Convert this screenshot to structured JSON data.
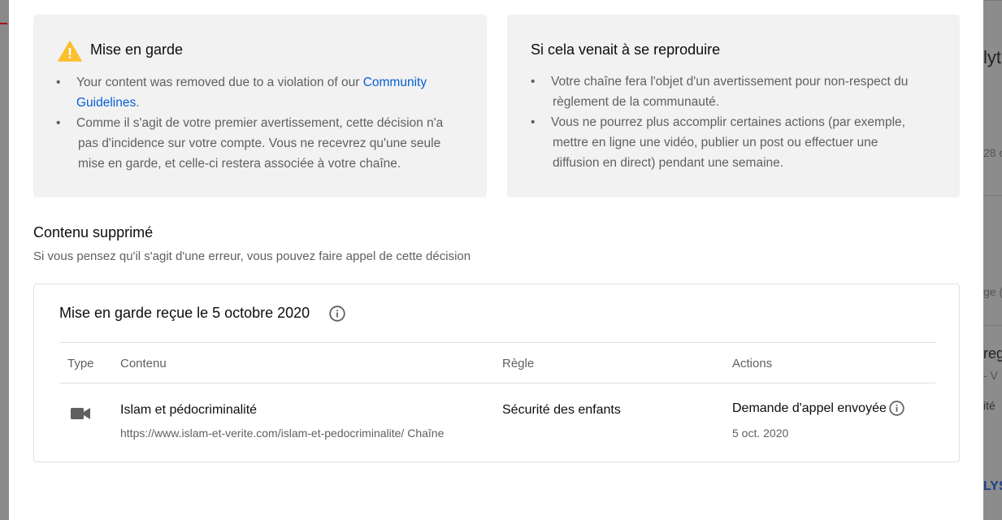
{
  "background": {
    "fragments": [
      "lyt",
      "28 c",
      "ge (",
      "reg",
      "- V",
      "ité",
      "LYS"
    ]
  },
  "warning_card": {
    "title": "Mise en garde",
    "icon": "warning-triangle-icon",
    "bullet1_text": "Your content was removed due to a violation of our ",
    "bullet1_link": "Community Guidelines",
    "bullet1_end": ".",
    "bullet2_line1": "Comme il s'agit de votre premier avertissement, cette décision n'a",
    "bullet2_line2": "pas d'incidence sur votre compte. Vous ne recevrez qu'une seule",
    "bullet2_line3": "mise en garde, et celle-ci restera associée à votre chaîne."
  },
  "repeat_card": {
    "title": "Si cela venait à se reproduire",
    "bullet1_line1": "Votre chaîne fera l'objet d'un avertissement pour non-respect du",
    "bullet1_line2": "règlement de la communauté.",
    "bullet2_line1": "Vous ne pourrez plus accomplir certaines actions (par exemple,",
    "bullet2_line2": "mettre en ligne une vidéo, publier un post ou effectuer une",
    "bullet2_line3": "diffusion en direct) pendant une semaine."
  },
  "removed_section": {
    "title": "Contenu supprimé",
    "subtitle": "Si vous pensez qu'il s'agit d'une erreur, vous pouvez faire appel de cette décision"
  },
  "strike": {
    "title": "Mise en garde reçue le 5 octobre 2020",
    "columns": [
      "Type",
      "Contenu",
      "Règle",
      "Actions"
    ],
    "row": {
      "type_icon": "video-camera-icon",
      "content_title": "Islam et pédocriminalité",
      "content_url": "https://www.islam-et-verite.com/islam-et-pedocriminalite/ Chaîne",
      "rule": "Sécurité des enfants",
      "action_status": "Demande d'appel envoyée",
      "action_date": "5 oct. 2020"
    }
  },
  "colors": {
    "link": "#065fd4",
    "warning": "#fbc02d",
    "card_bg": "#f2f2f2",
    "secondary_text": "#606060"
  }
}
